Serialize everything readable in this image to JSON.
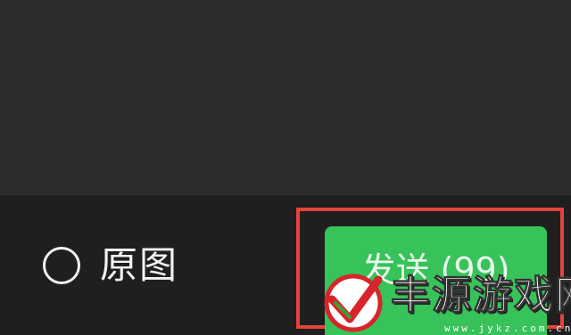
{
  "toolbar": {
    "original_image_label": "原图",
    "original_image_checked": false,
    "send_button_label": "发送 (99)"
  },
  "watermark": {
    "text": "丰源游戏网",
    "url": "www.jykz.com.cn"
  },
  "colors": {
    "background": "#2b2b2b",
    "bottom_bar": "#1f1f1f",
    "send_button": "#37c25a",
    "highlight_box": "#e5443a"
  },
  "icons": {
    "radio": "radio-unchecked-icon",
    "watermark_logo": "checkmark-logo-icon"
  }
}
